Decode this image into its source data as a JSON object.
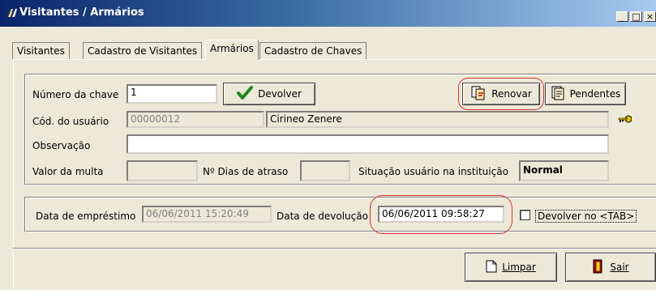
{
  "window": {
    "title": "Visitantes / Armários",
    "controls": {
      "minimize": "_",
      "restore": "□",
      "close": "×"
    }
  },
  "tabs": [
    {
      "label": "Visitantes"
    },
    {
      "label": "Cadastro de Visitantes"
    },
    {
      "label": "Armários",
      "active": true
    },
    {
      "label": "Cadastro de Chaves"
    }
  ],
  "form": {
    "key_number": {
      "label": "Número da chave",
      "value": "1"
    },
    "devolver_button": "Devolver",
    "renovar_button": "Renovar",
    "pendentes_button": "Pendentes",
    "user_code": {
      "label": "Cód. do usuário",
      "value": "00000012"
    },
    "user_name": {
      "value": "Cirineo Zenere"
    },
    "observacao": {
      "label": "Observação",
      "value": ""
    },
    "multa": {
      "label": "Valor da multa",
      "value": ""
    },
    "dias_atraso": {
      "label": "Nº Dias de atraso",
      "value": ""
    },
    "situacao": {
      "label": "Situação usuário na instituição",
      "value": "Normal"
    }
  },
  "dates": {
    "emprestimo": {
      "label": "Data de empréstimo",
      "value": "06/06/2011 15:20:49"
    },
    "devolucao": {
      "label": "Data de devolução",
      "value": "06/06/2011 09:58:27"
    },
    "devolver_tab": {
      "label": "Devolver no <TAB>",
      "checked": false
    }
  },
  "footer": {
    "limpar_button": "Limpar",
    "sair_button": "Sair"
  },
  "colors": {
    "highlight_circle": "#e03030",
    "status_normal": "#008000",
    "titlebar_start": "#0a246a",
    "titlebar_end": "#a6caf0"
  }
}
